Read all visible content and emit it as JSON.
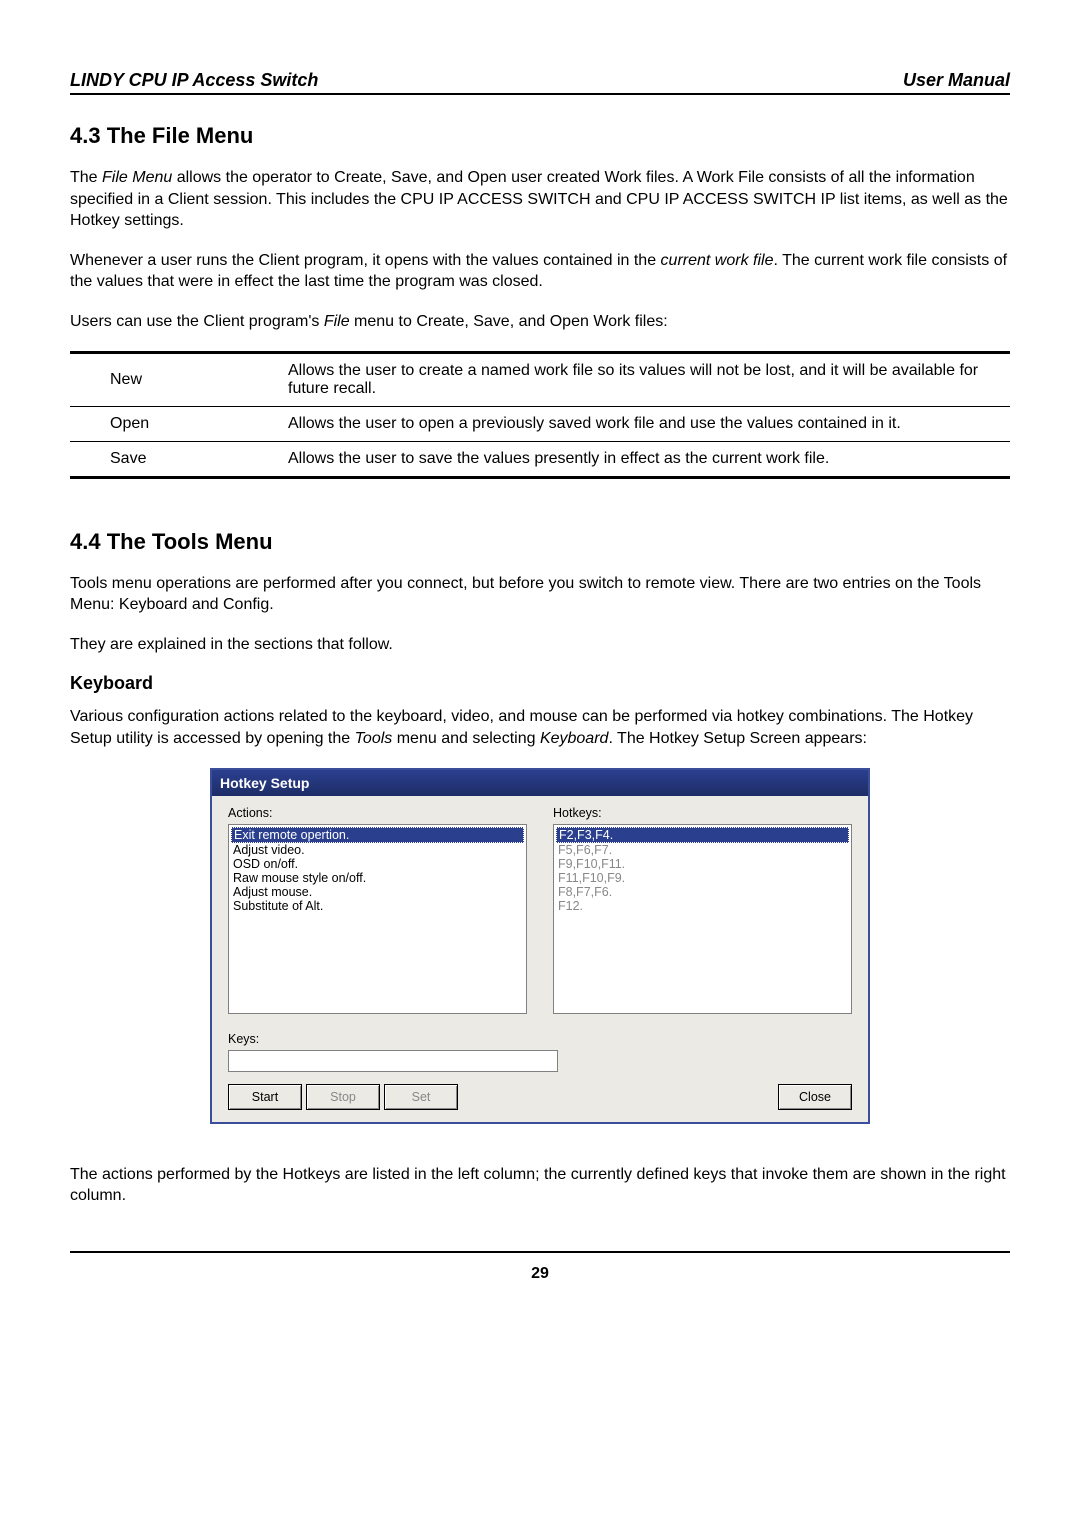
{
  "header": {
    "left": "LINDY CPU IP Access Switch",
    "right": "User Manual"
  },
  "s43": {
    "title": "4.3 The File Menu",
    "p1a": "The ",
    "p1b": "File Menu",
    "p1c": " allows the operator to Create, Save, and Open user created Work files. A Work File consists of all the information specified in a Client session. This includes the CPU IP ACCESS SWITCH and CPU IP ACCESS SWITCH IP list items, as well as the Hotkey settings.",
    "p2a": "Whenever a user runs the Client program, it opens with the values contained in the ",
    "p2b": "current work file",
    "p2c": ". The current work file consists of the values that were in effect the last time the program was closed.",
    "p3a": "Users can use the Client program's ",
    "p3b": "File",
    "p3c": " menu to Create, Save, and Open Work files:",
    "rows": [
      {
        "name": "New",
        "desc": "Allows the user to create a named work file so its values will not be lost, and it will be available for future recall."
      },
      {
        "name": "Open",
        "desc": "Allows the user to open a previously saved work file and use the values contained in it."
      },
      {
        "name": "Save",
        "desc": "Allows the user to save the values presently in effect as the current work file."
      }
    ]
  },
  "s44": {
    "title": "4.4 The Tools Menu",
    "p1": "Tools menu operations are performed after you connect, but before you switch to remote view. There are two entries on the Tools Menu: Keyboard and Config.",
    "p2": "They are explained in the sections that follow.",
    "kb_title": "Keyboard",
    "kb_p_a": "Various configuration actions related to the keyboard, video, and mouse can be performed via hotkey combinations. The Hotkey Setup utility is accessed by opening the ",
    "kb_p_b": "Tools",
    "kb_p_c": " menu and selecting ",
    "kb_p_d": "Keyboard",
    "kb_p_e": ". The Hotkey Setup Screen appears:"
  },
  "hotkey": {
    "title": "Hotkey Setup",
    "actions_label": "Actions:",
    "hotkeys_label": "Hotkeys:",
    "actions": [
      "Exit remote opertion.",
      "Adjust video.",
      "OSD on/off.",
      "Raw mouse style on/off.",
      "Adjust mouse.",
      "Substitute of Alt."
    ],
    "hotkeys": [
      "F2,F3,F4.",
      "F5,F6,F7.",
      "F9,F10,F11.",
      "F11,F10,F9.",
      "F8,F7,F6.",
      "F12."
    ],
    "keys_label": "Keys:",
    "btn_start": "Start",
    "btn_stop": "Stop",
    "btn_set": "Set",
    "btn_close": "Close"
  },
  "after": "The actions performed by the Hotkeys are listed in the left column; the currently defined keys that invoke them are shown in the right column.",
  "pagenum": "29"
}
